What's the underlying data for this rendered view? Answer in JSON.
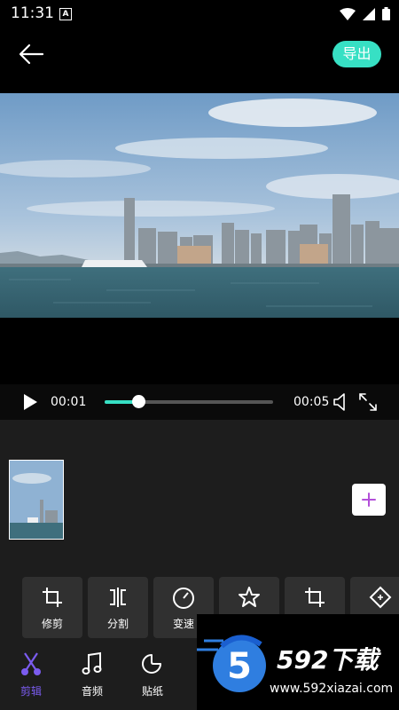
{
  "status_bar": {
    "time": "11:31",
    "notification_badge": "A"
  },
  "header": {
    "export_label": "导出"
  },
  "player": {
    "current_time": "00:01",
    "total_time": "00:05",
    "progress": 0.2
  },
  "tools": [
    {
      "label": "修剪",
      "icon": "crop-icon"
    },
    {
      "label": "分割",
      "icon": "split-icon"
    },
    {
      "label": "变速",
      "icon": "speed-icon"
    },
    {
      "label": "",
      "icon": "star-icon"
    },
    {
      "label": "",
      "icon": "crop-icon"
    },
    {
      "label": "",
      "icon": "diamond-icon"
    }
  ],
  "bottom_nav": [
    {
      "label": "剪辑",
      "icon": "scissors-icon",
      "active": true
    },
    {
      "label": "音频",
      "icon": "music-icon",
      "active": false
    },
    {
      "label": "贴纸",
      "icon": "sticker-icon",
      "active": false
    }
  ],
  "watermark": {
    "brand": "592下载",
    "url": "www.592xiazai.com"
  },
  "colors": {
    "accent": "#37e0c4",
    "active_nav": "#7b5cf0",
    "panel": "#1d1d1d",
    "tool_bg": "#303030"
  }
}
